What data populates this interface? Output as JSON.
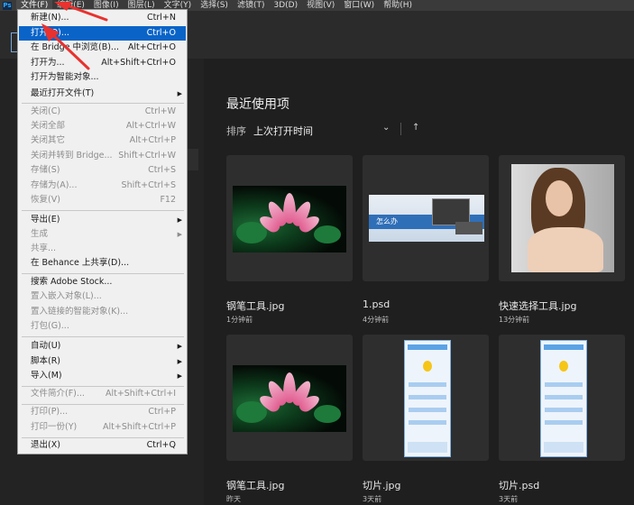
{
  "menubar": {
    "logo": "Ps",
    "items": [
      "文件(F)",
      "编辑(E)",
      "图像(I)",
      "图层(L)",
      "文字(Y)",
      "选择(S)",
      "滤镜(T)",
      "3D(D)",
      "视图(V)",
      "窗口(W)",
      "帮助(H)"
    ]
  },
  "home": {
    "title": "最近使用项",
    "sort_label": "排序",
    "sort_value": "上次打开时间",
    "files": [
      {
        "name": "钢笔工具.jpg",
        "time": "1分钟前"
      },
      {
        "name": "1.psd",
        "time": "4分钟前"
      },
      {
        "name": "快速选择工具.jpg",
        "time": "13分钟前"
      },
      {
        "name": "钢笔工具.jpg",
        "time": "昨天"
      },
      {
        "name": "切片.jpg",
        "time": "3天前"
      },
      {
        "name": "切片.psd",
        "time": "3天前"
      }
    ],
    "psd_thumb_text": "怎么办"
  },
  "file_menu": {
    "items": [
      {
        "label": "新建(N)...",
        "shortcut": "Ctrl+N"
      },
      {
        "label": "打开(O)...",
        "shortcut": "Ctrl+O"
      },
      {
        "label": "在 Bridge 中浏览(B)...",
        "shortcut": "Alt+Ctrl+O"
      },
      {
        "label": "打开为...",
        "shortcut": "Alt+Shift+Ctrl+O"
      },
      {
        "label": "打开为智能对象...",
        "shortcut": ""
      },
      {
        "label": "最近打开文件(T)",
        "shortcut": ""
      },
      {
        "label": "关闭(C)",
        "shortcut": "Ctrl+W"
      },
      {
        "label": "关闭全部",
        "shortcut": "Alt+Ctrl+W"
      },
      {
        "label": "关闭其它",
        "shortcut": "Alt+Ctrl+P"
      },
      {
        "label": "关闭并转到 Bridge...",
        "shortcut": "Shift+Ctrl+W"
      },
      {
        "label": "存储(S)",
        "shortcut": "Ctrl+S"
      },
      {
        "label": "存储为(A)...",
        "shortcut": "Shift+Ctrl+S"
      },
      {
        "label": "恢复(V)",
        "shortcut": "F12"
      },
      {
        "label": "导出(E)",
        "shortcut": ""
      },
      {
        "label": "生成",
        "shortcut": ""
      },
      {
        "label": "共享...",
        "shortcut": ""
      },
      {
        "label": "在 Behance 上共享(D)...",
        "shortcut": ""
      },
      {
        "label": "搜索 Adobe Stock...",
        "shortcut": ""
      },
      {
        "label": "置入嵌入对象(L)...",
        "shortcut": ""
      },
      {
        "label": "置入链接的智能对象(K)...",
        "shortcut": ""
      },
      {
        "label": "打包(G)...",
        "shortcut": ""
      },
      {
        "label": "自动(U)",
        "shortcut": ""
      },
      {
        "label": "脚本(R)",
        "shortcut": ""
      },
      {
        "label": "导入(M)",
        "shortcut": ""
      },
      {
        "label": "文件简介(F)...",
        "shortcut": "Alt+Shift+Ctrl+I"
      },
      {
        "label": "打印(P)...",
        "shortcut": "Ctrl+P"
      },
      {
        "label": "打印一份(Y)",
        "shortcut": "Alt+Shift+Ctrl+P"
      },
      {
        "label": "退出(X)",
        "shortcut": "Ctrl+Q"
      }
    ]
  },
  "colors": {
    "highlight": "#0a64c8",
    "annotation": "#e8322f"
  }
}
